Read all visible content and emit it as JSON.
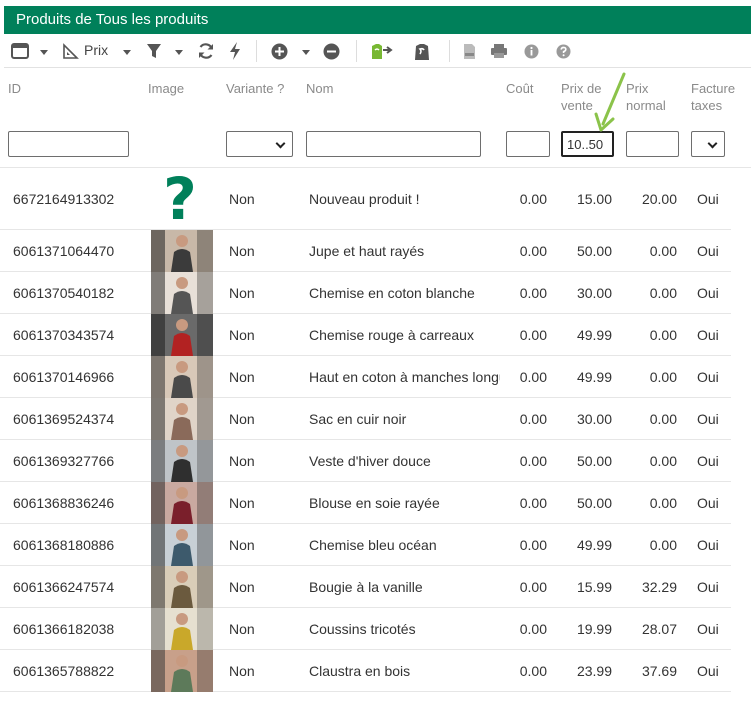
{
  "title": "Produits de Tous les produits",
  "toolbar": {
    "prix_label": "Prix",
    "icons": [
      "view-icon",
      "ruler-icon",
      "filter-icon",
      "refresh-icon",
      "lightning-icon",
      "add-circle-icon",
      "remove-circle-icon",
      "shopify-export-icon",
      "shopify-icon",
      "csv-icon",
      "print-icon",
      "info-icon",
      "help-icon"
    ]
  },
  "columns": {
    "id": "ID",
    "image": "Image",
    "variante": "Variante ?",
    "nom": "Nom",
    "cout": "Coût",
    "prix_vente_1": "Prix de",
    "prix_vente_2": "vente",
    "prix_normal_1": "Prix",
    "prix_normal_2": "normal",
    "facture_1": "Facture",
    "facture_2": "taxes"
  },
  "filters": {
    "id": "",
    "nom": "",
    "cout": "",
    "prix_vente": "10..50",
    "prix_normal": ""
  },
  "rows": [
    {
      "id": "6672164913302",
      "variante": "Non",
      "nom": "Nouveau produit !",
      "cout": "0.00",
      "prix_vente": "15.00",
      "prix_normal": "20.00",
      "facture": "Oui",
      "image": "missing"
    },
    {
      "id": "6061371064470",
      "variante": "Non",
      "nom": "Jupe et haut rayés",
      "cout": "0.00",
      "prix_vente": "50.00",
      "prix_normal": "0.00",
      "facture": "Oui",
      "image": "photo"
    },
    {
      "id": "6061370540182",
      "variante": "Non",
      "nom": "Chemise en coton blanche",
      "cout": "0.00",
      "prix_vente": "30.00",
      "prix_normal": "0.00",
      "facture": "Oui",
      "image": "photo"
    },
    {
      "id": "6061370343574",
      "variante": "Non",
      "nom": "Chemise rouge à carreaux",
      "cout": "0.00",
      "prix_vente": "49.99",
      "prix_normal": "0.00",
      "facture": "Oui",
      "image": "photo"
    },
    {
      "id": "6061370146966",
      "variante": "Non",
      "nom": "Haut en coton à manches longues",
      "cout": "0.00",
      "prix_vente": "49.99",
      "prix_normal": "0.00",
      "facture": "Oui",
      "image": "photo"
    },
    {
      "id": "6061369524374",
      "variante": "Non",
      "nom": "Sac en cuir noir",
      "cout": "0.00",
      "prix_vente": "30.00",
      "prix_normal": "0.00",
      "facture": "Oui",
      "image": "photo"
    },
    {
      "id": "6061369327766",
      "variante": "Non",
      "nom": "Veste d'hiver douce",
      "cout": "0.00",
      "prix_vente": "50.00",
      "prix_normal": "0.00",
      "facture": "Oui",
      "image": "photo"
    },
    {
      "id": "6061368836246",
      "variante": "Non",
      "nom": "Blouse en soie rayée",
      "cout": "0.00",
      "prix_vente": "50.00",
      "prix_normal": "0.00",
      "facture": "Oui",
      "image": "photo"
    },
    {
      "id": "6061368180886",
      "variante": "Non",
      "nom": "Chemise bleu océan",
      "cout": "0.00",
      "prix_vente": "49.99",
      "prix_normal": "0.00",
      "facture": "Oui",
      "image": "photo"
    },
    {
      "id": "6061366247574",
      "variante": "Non",
      "nom": "Bougie à la vanille",
      "cout": "0.00",
      "prix_vente": "15.99",
      "prix_normal": "32.29",
      "facture": "Oui",
      "image": "photo"
    },
    {
      "id": "6061366182038",
      "variante": "Non",
      "nom": "Coussins tricotés",
      "cout": "0.00",
      "prix_vente": "19.99",
      "prix_normal": "28.07",
      "facture": "Oui",
      "image": "photo"
    },
    {
      "id": "6061365788822",
      "variante": "Non",
      "nom": "Claustra en bois",
      "cout": "0.00",
      "prix_vente": "23.99",
      "prix_normal": "37.69",
      "facture": "Oui",
      "image": "photo"
    }
  ],
  "colors": {
    "brand": "#00805a",
    "annotation_arrow": "#8bc34a"
  }
}
